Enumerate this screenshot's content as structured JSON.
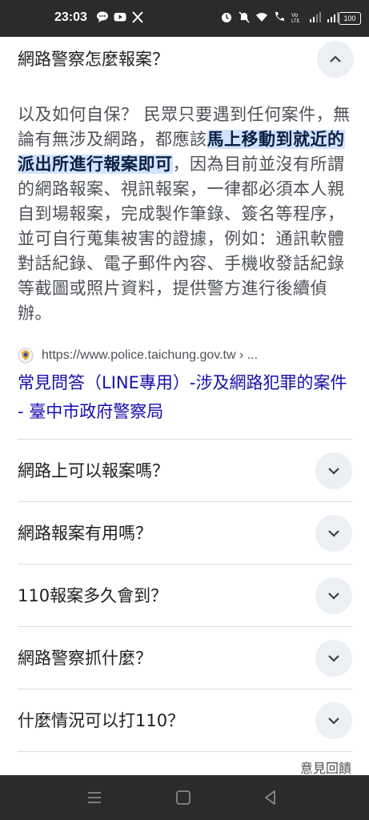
{
  "status_bar": {
    "time": "23:03",
    "battery": "100",
    "left_icons": [
      "chat-bubble-icon",
      "youtube-icon",
      "x-icon"
    ],
    "right_icons": [
      "alarm-icon",
      "mute-icon",
      "wifi-icon",
      "call-icon",
      "volte-icon",
      "signal-icon",
      "signal-icon"
    ]
  },
  "expanded_faq": {
    "question": "網路警察怎麼報案？",
    "answer_pre": "以及如何自保？ 民眾只要遇到任何案件，無論有無涉及網路，都應該",
    "answer_highlight": "馬上移動到就近的派出所進行報案即可",
    "answer_post": "，因為目前並沒有所謂的網路報案、視訊報案，一律都必須本人親自到場報案，完成製作筆錄、簽名等程序，並可自行蒐集被害的證據，例如：通訊軟體對話紀錄、電子郵件內容、手機收發話紀錄等截圖或照片資料，提供警方進行後續偵辦。",
    "source_url": "https://www.police.taichung.gov.tw › ...",
    "source_title": "常見問答（LINE專用）-涉及網路犯罪的案件 - 臺中市政府警察局"
  },
  "faqs": [
    {
      "question": "網路上可以報案嗎？"
    },
    {
      "question": "網路報案有用嗎？"
    },
    {
      "question": "110報案多久會到？"
    },
    {
      "question": "網路警察抓什麼？"
    },
    {
      "question": "什麼情況可以打110？"
    }
  ],
  "feedback_label": "意見回饋",
  "colors": {
    "link": "#1a0dab",
    "highlight": "#d3e3fd",
    "chevron_bg": "#eceff3",
    "bars": "#2b2b2b"
  }
}
